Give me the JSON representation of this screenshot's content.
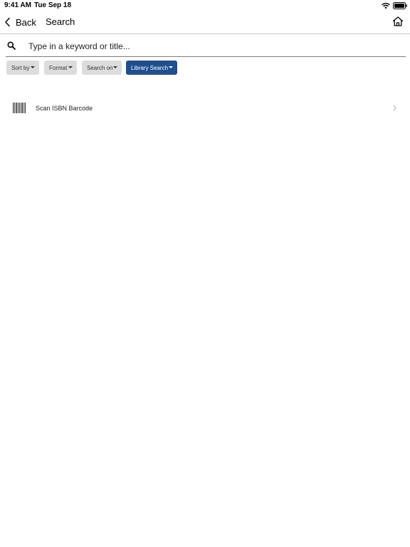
{
  "status_bar": {
    "time": "9:41 AM",
    "date": "Tue Sep 18",
    "icons": [
      "wifi-icon",
      "battery-icon"
    ]
  },
  "nav": {
    "back_label": "Back",
    "title": "Search",
    "icons": [
      "chevron-left-icon",
      "home-icon"
    ]
  },
  "search": {
    "placeholder": "Type in a keyword or title...",
    "value": "",
    "icon": "search-icon"
  },
  "filters": [
    {
      "label": "Sort by",
      "selected": false
    },
    {
      "label": "Format",
      "selected": false
    },
    {
      "label": "Search on",
      "selected": false
    },
    {
      "label": "Library Search",
      "selected": true
    }
  ],
  "scan": {
    "label": "Scan ISBN Barcode",
    "icon": "barcode-icon"
  },
  "colors": {
    "accent": "#1f4f8f",
    "chip_bg": "#dcdcdc",
    "divider": "#c8c8c8"
  }
}
